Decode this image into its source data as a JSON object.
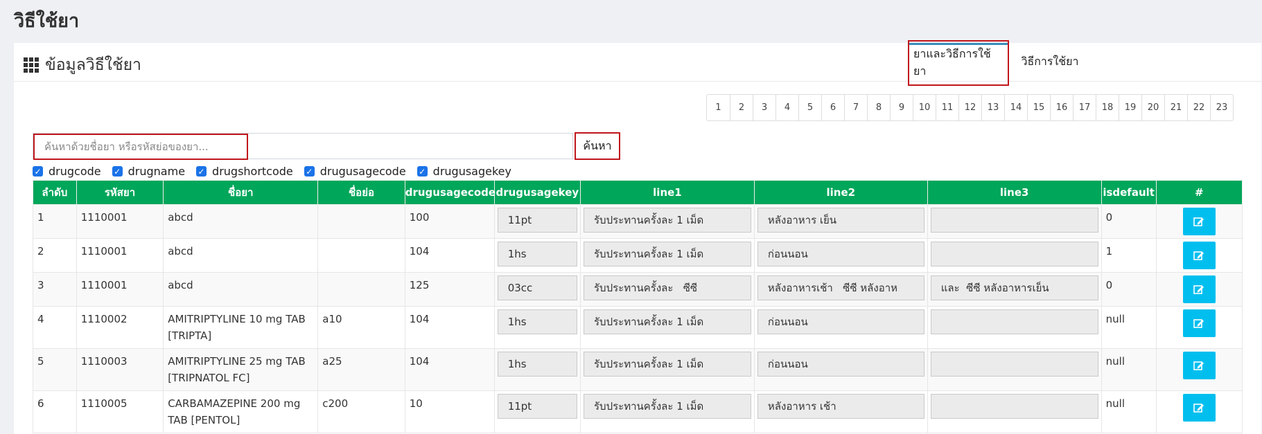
{
  "page_title": "วิธีใช้ยา",
  "panel": {
    "title": "ข้อมูลวิธีใช้ยา",
    "icon": "grid-icon"
  },
  "tabs": [
    {
      "label": "ยาและวิธีการใช้ยา",
      "active": true
    },
    {
      "label": "วิธีการใช้ยา",
      "active": false
    }
  ],
  "pagination": [
    "1",
    "2",
    "3",
    "4",
    "5",
    "6",
    "7",
    "8",
    "9",
    "10",
    "11",
    "12",
    "13",
    "14",
    "15",
    "16",
    "17",
    "18",
    "19",
    "20",
    "21",
    "22",
    "23"
  ],
  "search": {
    "placeholder": "ค้นหาด้วยชื่อยา หรือรหัสย่อของยา...",
    "value": "",
    "button_label": "ค้นหา"
  },
  "column_toggles": [
    {
      "label": "drugcode",
      "checked": true
    },
    {
      "label": "drugname",
      "checked": true
    },
    {
      "label": "drugshortcode",
      "checked": true
    },
    {
      "label": "drugusagecode",
      "checked": true
    },
    {
      "label": "drugusagekey",
      "checked": true
    }
  ],
  "table": {
    "headers": [
      "ลำดับ",
      "รหัสยา",
      "ชื่อยา",
      "ชื่อย่อ",
      "drugusagecode",
      "drugusagekey",
      "line1",
      "line2",
      "line3",
      "isdefault",
      "#"
    ],
    "rows": [
      {
        "no": "1",
        "code": "1110001",
        "name": "abcd",
        "short": "",
        "usagecode": "100",
        "usagekey": "11pt",
        "line1": "รับประทานครั้งละ 1 เม็ด",
        "line2": "หลังอาหาร เย็น",
        "line3": "",
        "isdefault": "0"
      },
      {
        "no": "2",
        "code": "1110001",
        "name": "abcd",
        "short": "",
        "usagecode": "104",
        "usagekey": "1hs",
        "line1": "รับประทานครั้งละ 1 เม็ด",
        "line2": "ก่อนนอน",
        "line3": "",
        "isdefault": "1"
      },
      {
        "no": "3",
        "code": "1110001",
        "name": "abcd",
        "short": "",
        "usagecode": "125",
        "usagekey": "03cc",
        "line1": "รับประทานครั้งละ   ซีซี",
        "line2": "หลังอาหารเช้า   ซีซี หลังอาห",
        "line3": "และ  ซีซี หลังอาหารเย็น",
        "isdefault": "0"
      },
      {
        "no": "4",
        "code": "1110002",
        "name": "AMITRIPTYLINE 10 mg TAB [TRIPTA]",
        "short": "a10",
        "usagecode": "104",
        "usagekey": "1hs",
        "line1": "รับประทานครั้งละ 1 เม็ด",
        "line2": "ก่อนนอน",
        "line3": "",
        "isdefault": "null"
      },
      {
        "no": "5",
        "code": "1110003",
        "name": "AMITRIPTYLINE 25 mg TAB [TRIPNATOL FC]",
        "short": "a25",
        "usagecode": "104",
        "usagekey": "1hs",
        "line1": "รับประทานครั้งละ 1 เม็ด",
        "line2": "ก่อนนอน",
        "line3": "",
        "isdefault": "null"
      },
      {
        "no": "6",
        "code": "1110005",
        "name": "CARBAMAZEPINE 200 mg TAB [PENTOL]",
        "short": "c200",
        "usagecode": "10",
        "usagekey": "11pt",
        "line1": "รับประทานครั้งละ 1 เม็ด",
        "line2": "หลังอาหาร เช้า",
        "line3": "",
        "isdefault": "null"
      }
    ]
  },
  "colors": {
    "header_green": "#00a65a",
    "edit_button": "#00bfef",
    "highlight_red": "#c0161b",
    "tab_accent": "#3c8dbc"
  }
}
